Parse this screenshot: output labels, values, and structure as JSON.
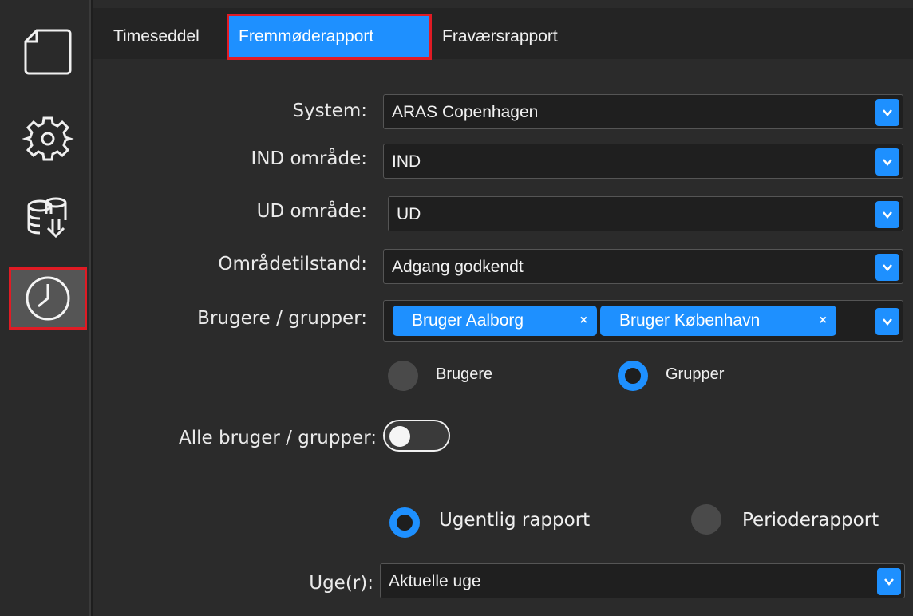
{
  "sidebar": {
    "items": [
      {
        "name": "document",
        "icon": "document-icon",
        "active": false
      },
      {
        "name": "settings",
        "icon": "gear-icon",
        "active": false
      },
      {
        "name": "database-import",
        "icon": "database-download-icon",
        "active": false
      },
      {
        "name": "reports",
        "icon": "clock-icon",
        "active": true
      }
    ]
  },
  "tabs": [
    {
      "label": "Timeseddel",
      "active": false
    },
    {
      "label": "Fremmøderapport",
      "active": true
    },
    {
      "label": "Fraværsrapport",
      "active": false
    }
  ],
  "form": {
    "system": {
      "label": "System:",
      "value": "ARAS Copenhagen"
    },
    "ind_area": {
      "label": "IND område:",
      "value": "IND"
    },
    "ud_area": {
      "label": "UD område:",
      "value": "UD"
    },
    "area_state": {
      "label": "Områdetilstand:",
      "value": "Adgang godkendt"
    },
    "users_groups": {
      "label": "Brugere / grupper:",
      "chips": [
        "Bruger Aalborg",
        "Bruger København"
      ],
      "remove_symbol": "×"
    },
    "select_type": {
      "options": [
        {
          "label": "Brugere",
          "selected": false
        },
        {
          "label": "Grupper",
          "selected": true
        }
      ]
    },
    "all_users_groups": {
      "label": "Alle bruger / grupper:",
      "on": false
    },
    "report_type": {
      "options": [
        {
          "label": "Ugentlig rapport",
          "selected": true
        },
        {
          "label": "Perioderapport",
          "selected": false
        }
      ]
    },
    "weeks": {
      "label": "Uge(r):",
      "value": "Aktuelle uge"
    }
  },
  "colors": {
    "accent": "#1e90ff",
    "highlight_outline": "#e01b24",
    "background": "#2b2b2b"
  }
}
